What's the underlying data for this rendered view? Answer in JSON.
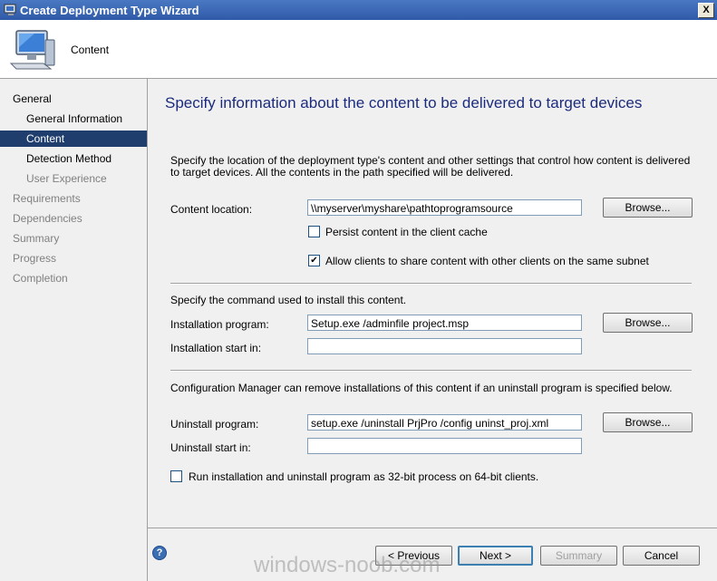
{
  "window": {
    "title": "Create Deployment Type Wizard",
    "close_label": "X"
  },
  "header": {
    "title": "Content"
  },
  "nav": {
    "items": [
      {
        "label": "General",
        "state": "normal"
      },
      {
        "label": "General Information",
        "state": "normal"
      },
      {
        "label": "Content",
        "state": "selected"
      },
      {
        "label": "Detection Method",
        "state": "normal"
      },
      {
        "label": "User Experience",
        "state": "dim"
      },
      {
        "label": "Requirements",
        "state": "dim"
      },
      {
        "label": "Dependencies",
        "state": "dim"
      },
      {
        "label": "Summary",
        "state": "dim"
      },
      {
        "label": "Progress",
        "state": "dim"
      },
      {
        "label": "Completion",
        "state": "dim"
      }
    ]
  },
  "main": {
    "heading": "Specify information about the content to be delivered to target devices",
    "description": "Specify the location of the deployment type's content and other settings that control how content is delivered to target devices. All the contents in the path specified will be delivered.",
    "content_location_label": "Content location:",
    "content_location_value": "\\\\myserver\\myshare\\pathtoprogramsource",
    "browse_label": "Browse...",
    "persist_label": "Persist content in the client cache",
    "persist_checked": false,
    "allow_share_label": "Allow clients to share content with other clients on the same subnet",
    "allow_share_checked": true,
    "install_section": "Specify the command used to install this content.",
    "install_program_label": "Installation program:",
    "install_program_value": "Setup.exe /adminfile project.msp",
    "install_start_label": "Installation start in:",
    "install_start_value": "",
    "uninstall_section": "Configuration Manager can remove installations of this content if an uninstall program is specified below.",
    "uninstall_program_label": "Uninstall program:",
    "uninstall_program_value": "setup.exe /uninstall PrjPro /config uninst_proj.xml",
    "uninstall_start_label": "Uninstall start in:",
    "uninstall_start_value": "",
    "run32_label": "Run installation and uninstall program as 32-bit process on 64-bit clients.",
    "run32_checked": false
  },
  "footer": {
    "previous_label": "< Previous",
    "next_label": "Next >",
    "summary_label": "Summary",
    "cancel_label": "Cancel",
    "help_label": "?"
  },
  "watermark": "windows-noob.com"
}
